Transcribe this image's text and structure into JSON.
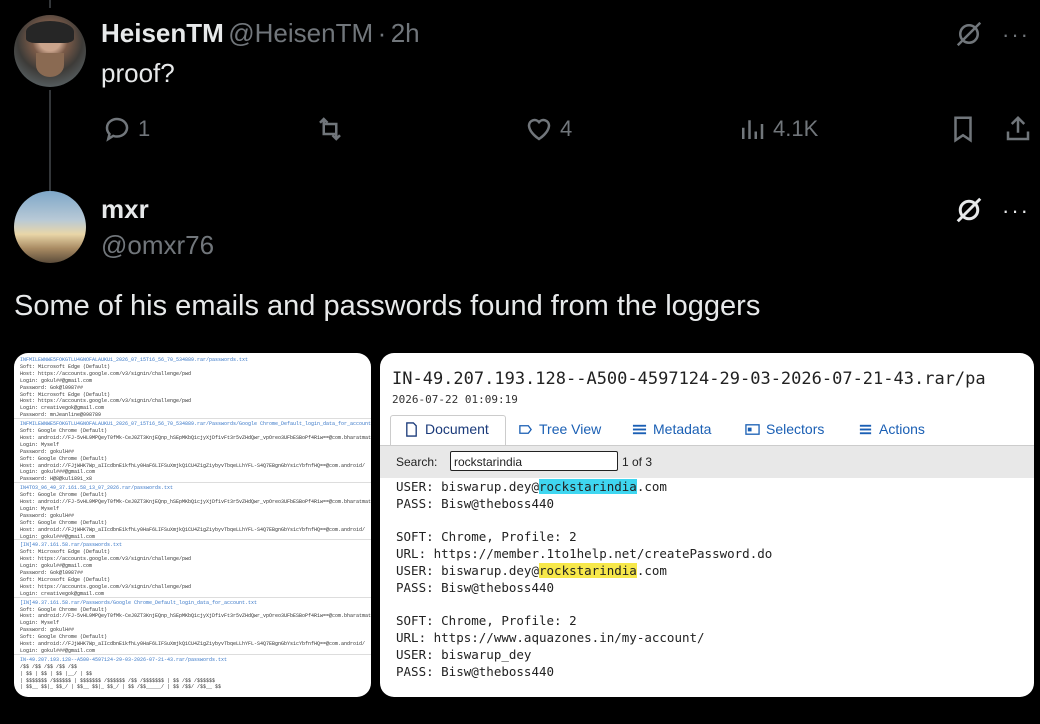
{
  "tweet1": {
    "display_name": "HeisenTM",
    "handle": "@HeisenTM",
    "separator": "·",
    "time": "2h",
    "text": "proof?",
    "actions": {
      "replies": "1",
      "retweets": "",
      "likes": "4",
      "views": "4.1K"
    }
  },
  "tweet2": {
    "display_name": "mxr",
    "handle": "@omxr76",
    "text": "Some of his emails and passwords found from the loggers"
  },
  "more_label": "···",
  "left_image": {
    "lines": [
      {
        "text": "INFMILEWNWE5FOKGTLU4GNOFALAUKU1_2026_07_15T16_56_70_534889.rar/passwords.txt",
        "blue": true
      },
      {
        "text": "Soft: Microsoft Edge (Default)",
        "blue": false
      },
      {
        "text": "Host: https://accounts.google.com/v3/signin/challenge/pwd",
        "blue": false
      },
      {
        "text": "Login: gokul##@gmail.com",
        "blue": false
      },
      {
        "text": "Password: Gok@l0987##",
        "blue": false
      },
      {
        "text": "Soft: Microsoft Edge (Default)",
        "blue": false
      },
      {
        "text": "Host: https://accounts.google.com/v3/signin/challenge/pwd",
        "blue": false
      },
      {
        "text": "Login: creativegok@gmail.com",
        "blue": false
      },
      {
        "text": "Password: mnJeanline@098789",
        "blue": false
      },
      {
        "text": "INFMILEWNWE5FOKGTLU4GNOFALAUKU1_2026_07_15T16_56_70_534889.rar/Passwords/Google Chrome_Default_login_data_for_account.txt",
        "blue": true
      },
      {
        "text": "Soft: Google Chrome (Default)",
        "blue": false
      },
      {
        "text": "Host: android://FJ-5vHL9MPQeyT0fMk-CeJ0ZT3KnjEQnp_hSEpMKbQ1cjyXjDf1vFt3r5vZHdQwr_vpOreo3UFbESBoPf4R1w==@com.bharatmatrimony/",
        "blue": false
      },
      {
        "text": "Login: Myself",
        "blue": false
      },
      {
        "text": "Password: gokulH##",
        "blue": false
      },
      {
        "text": "Soft: Google Chrome (Default)",
        "blue": false
      },
      {
        "text": "Host: android://FJjWHK7Wp_aIIcdbnE1kfhLy0HaF6LIFSuXmjkQ1CU4Z1gZiybyvTbqeLLhYFL-S4Q7EBgnGbYs1cYbfnfHQ==@com.android/",
        "blue": false
      },
      {
        "text": "Login: gokul###@gmail.com",
        "blue": false
      },
      {
        "text": "Password: H@8@kul1891_x8",
        "blue": false
      },
      {
        "text": "IN4TO3_96_49_37.161.58_13_07_2026.rar/passwords.txt",
        "blue": true
      },
      {
        "text": "Soft: Google Chrome (Default)",
        "blue": false
      },
      {
        "text": "Host: android://FJ-5vHL9MPQeyT0fMk-CeJ0ZT3KnjEQnp_hSEpMKbQ1cjyXjDf1vFt3r5vZHdQwr_vpOreo3UFbESBoPf4R1w==@com.bharatmatrimony/",
        "blue": false
      },
      {
        "text": "Login: Myself",
        "blue": false
      },
      {
        "text": "Password: gokulH##",
        "blue": false
      },
      {
        "text": "Soft: Google Chrome (Default)",
        "blue": false
      },
      {
        "text": "Host: android://FJjWHK7Wp_aIIcdbnE1kfhLy0HaF6LIFSuXmjkQ1CU4Z1gZiybyvTbqeLLhYFL-S4Q7EBgnGbYs1cYbfnfHQ==@com.android/",
        "blue": false
      },
      {
        "text": "Login: gokul###@gmail.com",
        "blue": false
      },
      {
        "text": "[IN]49.37.161.58.rar/passwords.txt",
        "blue": true
      },
      {
        "text": "Soft: Microsoft Edge (Default)",
        "blue": false
      },
      {
        "text": "Host: https://accounts.google.com/v3/signin/challenge/pwd",
        "blue": false
      },
      {
        "text": "Login: gokul##@gmail.com",
        "blue": false
      },
      {
        "text": "Password: Gok@l0987##",
        "blue": false
      },
      {
        "text": "Soft: Microsoft Edge (Default)",
        "blue": false
      },
      {
        "text": "Host: https://accounts.google.com/v3/signin/challenge/pwd",
        "blue": false
      },
      {
        "text": "Login: creativegok@gmail.com",
        "blue": false
      },
      {
        "text": "[IN]49.37.161.58.rar/Passwords/Google Chrome_Default_login_data_for_account.txt",
        "blue": true
      },
      {
        "text": "Soft: Google Chrome (Default)",
        "blue": false
      },
      {
        "text": "Host: android://FJ-5vHL9MPQeyT0fMk-CeJ0ZT3KnjEQnp_hSEpMKbQ1cjyXjDf1vFt3r5vZHdQwr_vpOreo3UFbESBoPf4R1w==@com.bharatmatrimony/",
        "blue": false
      },
      {
        "text": "Login: Myself",
        "blue": false
      },
      {
        "text": "Password: gokulH##",
        "blue": false
      },
      {
        "text": "Soft: Google Chrome (Default)",
        "blue": false
      },
      {
        "text": "Host: android://FJjWHK7Wp_aIIcdbnE1kfhLy0HaF6LIFSuXmjkQ1CU4Z1gZiybyvTbqeLLhYFL-S4Q7EBgnGbYs1cYbfnfHQ==@com.android/",
        "blue": false
      },
      {
        "text": "Login: gokul###@gmail.com",
        "blue": false
      },
      {
        "text": "IN-49.207.193.128--A500-4597124-29-03-2026-07-21-43.rar/passwords.txt",
        "blue": true
      },
      {
        "text": "/$$          /$$     /$$            /$$                 /$$",
        "blue": false
      },
      {
        "text": "| $$         | $$    | $$           |__/                | $$",
        "blue": false
      },
      {
        "text": "| $$$$$$$  /$$$$$$  | $$$$$$$  /$$$$$$  /$$  /$$$$$$$ | $$  /$$   /$$$$$$",
        "blue": false
      },
      {
        "text": "| $$__  $$|_  $$_/  | $$__  $$|_  $$_/ | $$ /$$_____/ | $$ /$$/  /$$__  $$",
        "blue": false
      }
    ]
  },
  "right_image": {
    "title": "IN-49.207.193.128--A500-4597124-29-03-2026-07-21-43.rar/pa",
    "date": "2026-07-22 01:09:19",
    "tabs": [
      {
        "label": "Document",
        "icon": "document-icon"
      },
      {
        "label": "Tree View",
        "icon": "tree-view-icon"
      },
      {
        "label": "Metadata",
        "icon": "metadata-icon"
      },
      {
        "label": "Selectors",
        "icon": "selectors-icon"
      },
      {
        "label": "Actions",
        "icon": "actions-icon"
      }
    ],
    "search": {
      "label": "Search:",
      "value": "rockstarindia",
      "count": "1 of 3"
    },
    "lines": [
      {
        "pre": "USER: biswarup.dey@",
        "hl": "rockstarindia",
        "post": ".com",
        "hl_color": "#3fd6f0"
      },
      {
        "pre": "PASS: Bisw@theboss440",
        "hl": "",
        "post": "",
        "hl_color": ""
      },
      {
        "pre": "",
        "hl": "",
        "post": "",
        "hl_color": ""
      },
      {
        "pre": "SOFT: Chrome, Profile: 2",
        "hl": "",
        "post": "",
        "hl_color": ""
      },
      {
        "pre": "URL: https://member.1to1help.net/createPassword.do",
        "hl": "",
        "post": "",
        "hl_color": ""
      },
      {
        "pre": "USER: biswarup.dey@",
        "hl": "rockstarindia",
        "post": ".com",
        "hl_color": "#f7e84a"
      },
      {
        "pre": "PASS: Bisw@theboss440",
        "hl": "",
        "post": "",
        "hl_color": ""
      },
      {
        "pre": "",
        "hl": "",
        "post": "",
        "hl_color": ""
      },
      {
        "pre": "SOFT: Chrome, Profile: 2",
        "hl": "",
        "post": "",
        "hl_color": ""
      },
      {
        "pre": "URL: https://www.aquazones.in/my-account/",
        "hl": "",
        "post": "",
        "hl_color": ""
      },
      {
        "pre": "USER: biswarup_dey",
        "hl": "",
        "post": "",
        "hl_color": ""
      },
      {
        "pre": "PASS: Bisw@theboss440",
        "hl": "",
        "post": "",
        "hl_color": ""
      }
    ]
  }
}
